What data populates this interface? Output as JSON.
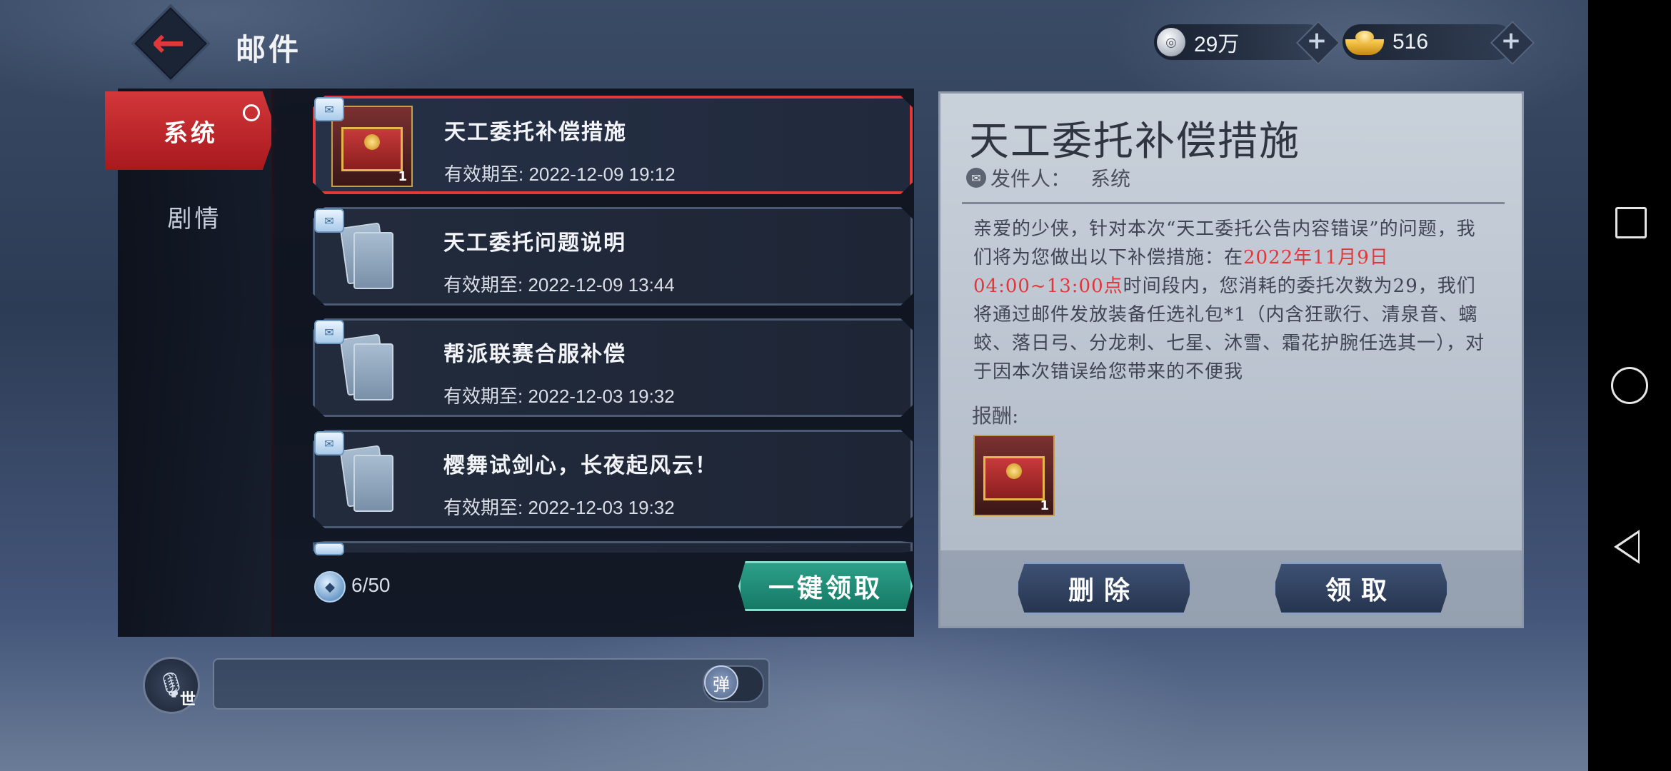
{
  "header": {
    "title": "邮件",
    "silver": "29万",
    "gold": "516"
  },
  "sidebar": {
    "tabs": [
      {
        "label": "系统",
        "active": true
      },
      {
        "label": "剧情",
        "active": false
      }
    ]
  },
  "mails": [
    {
      "title": "天工委托补偿措施",
      "expiry": "有效期至: 2022-12-09 19:12",
      "thumb": "chest",
      "count": "1"
    },
    {
      "title": "天工委托问题说明",
      "expiry": "有效期至: 2022-12-09 13:44",
      "thumb": "letter"
    },
    {
      "title": "帮派联赛合服补偿",
      "expiry": "有效期至: 2022-12-03 19:32",
      "thumb": "letter"
    },
    {
      "title": "樱舞试剑心，长夜起风云！",
      "expiry": "有效期至: 2022-12-03 19:32",
      "thumb": "letter"
    }
  ],
  "footer": {
    "mail_count": "6/50",
    "claim_all": "一键领取"
  },
  "detail": {
    "title": "天工委托补偿措施",
    "sender_label": "发件人：",
    "sender_name": "系统",
    "body_1": "亲爱的少侠，针对本次“天工委托公告内容错误”的问题，我们将为您做出以下补偿措施：在",
    "body_highlight": "2022年11月9日04:00~13:00点",
    "body_2": "时间段内，您消耗的委托次数为29，我们将通过邮件发放装备任选礼包*1（内含狂歌行、清泉音、螭蛟、落日弓、分龙刺、七星、沐雪、霜花护腕任选其一），对于因本次错误给您带来的不便我",
    "reward_label": "报酬:",
    "reward_count": "1",
    "delete_label": "删除",
    "claim_label": "领取",
    "highlight_color": "#e0383a"
  },
  "chat": {
    "world_label": "世",
    "danmaku_label": "弹"
  }
}
